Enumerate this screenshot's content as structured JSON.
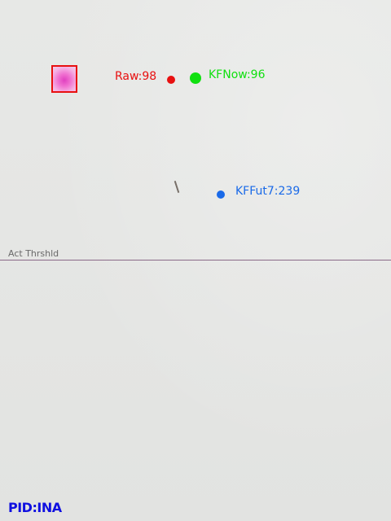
{
  "overlay": {
    "raw": {
      "label": "Raw:98",
      "color": "#e81010"
    },
    "kf_now": {
      "label": "KFNow:96",
      "color": "#10e010"
    },
    "kf_future": {
      "label": "KFFut7:239",
      "color": "#1a6ae8"
    },
    "threshold": {
      "label": "Act Thrshld",
      "color": "#8a6a88"
    },
    "pid": {
      "label": "PID:INA",
      "color": "#1010e0"
    }
  }
}
